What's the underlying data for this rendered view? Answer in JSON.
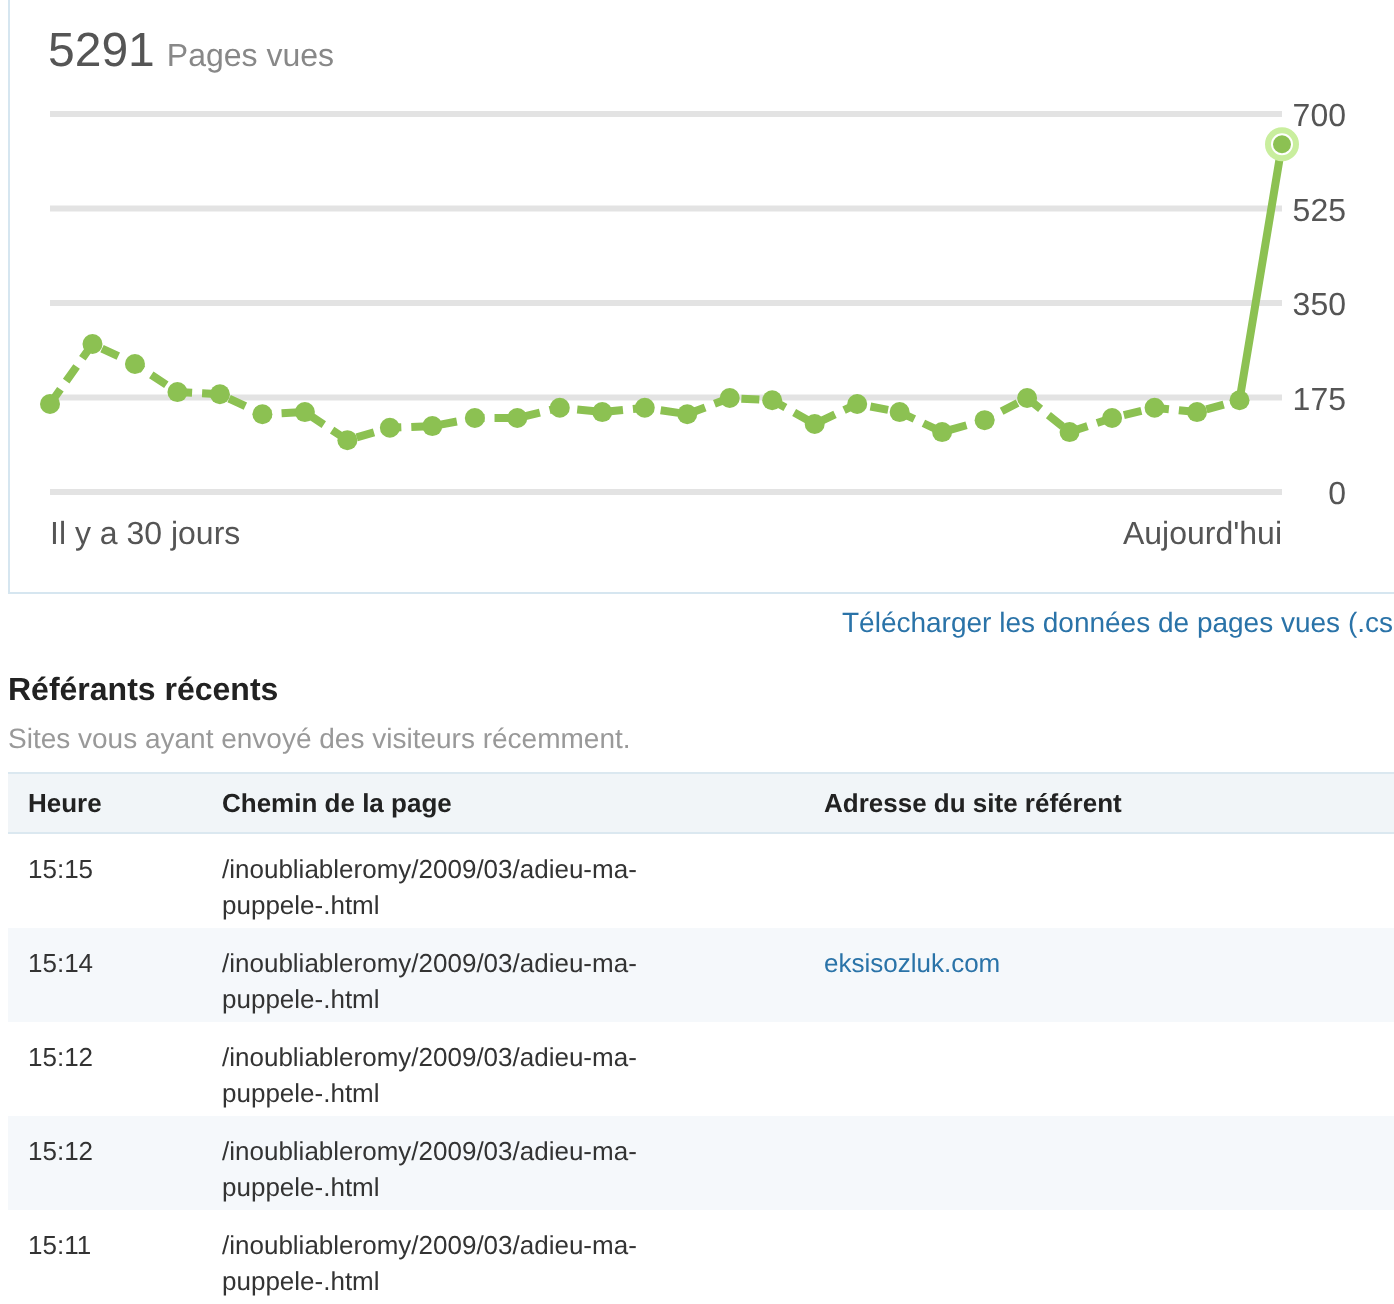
{
  "stats": {
    "count": "5291",
    "label": "Pages vues"
  },
  "chart_data": {
    "type": "line",
    "ylim": [
      0,
      700
    ],
    "yticks": [
      0,
      175,
      350,
      525,
      700
    ],
    "grid": true,
    "categories": [
      null,
      null,
      null,
      null,
      null,
      null,
      null,
      null,
      null,
      null,
      null,
      null,
      null,
      null,
      null,
      null,
      null,
      null,
      null,
      null,
      null,
      null,
      null,
      null,
      null,
      null,
      null,
      null,
      null,
      null
    ],
    "series": [
      {
        "color": "#8cc152",
        "line_style": "dashed",
        "marker": "circle",
        "values": [
          163,
          274,
          237,
          185,
          181,
          144,
          148,
          96,
          119,
          122,
          137,
          137,
          156,
          148,
          156,
          144,
          174,
          170,
          126,
          163,
          148,
          111,
          133,
          174,
          111,
          137,
          156,
          148,
          170,
          644
        ]
      }
    ]
  },
  "period_labels": {
    "start": "Il y a 30 jours",
    "end": "Aujourd'hui"
  },
  "download_link": "Télécharger les données de pages vues (.cs",
  "referrers": {
    "title": "Référants récents",
    "subtitle": "Sites vous ayant envoyé des visiteurs récemment.",
    "columns": [
      "Heure",
      "Chemin de la page",
      "Adresse du site référent"
    ],
    "rows": [
      {
        "time": "15:15",
        "path": "/inoubliableromy/2009/03/adieu-ma-puppele-.html"
      },
      {
        "time": "15:14",
        "path": "/inoubliableromy/2009/03/adieu-ma-puppele-.html",
        "referrer": "eksisozluk.com"
      },
      {
        "time": "15:12",
        "path": "/inoubliableromy/2009/03/adieu-ma-puppele-.html"
      },
      {
        "time": "15:12",
        "path": "/inoubliableromy/2009/03/adieu-ma-puppele-.html"
      },
      {
        "time": "15:11",
        "path": "/inoubliableromy/2009/03/adieu-ma-puppele-.html"
      }
    ]
  }
}
